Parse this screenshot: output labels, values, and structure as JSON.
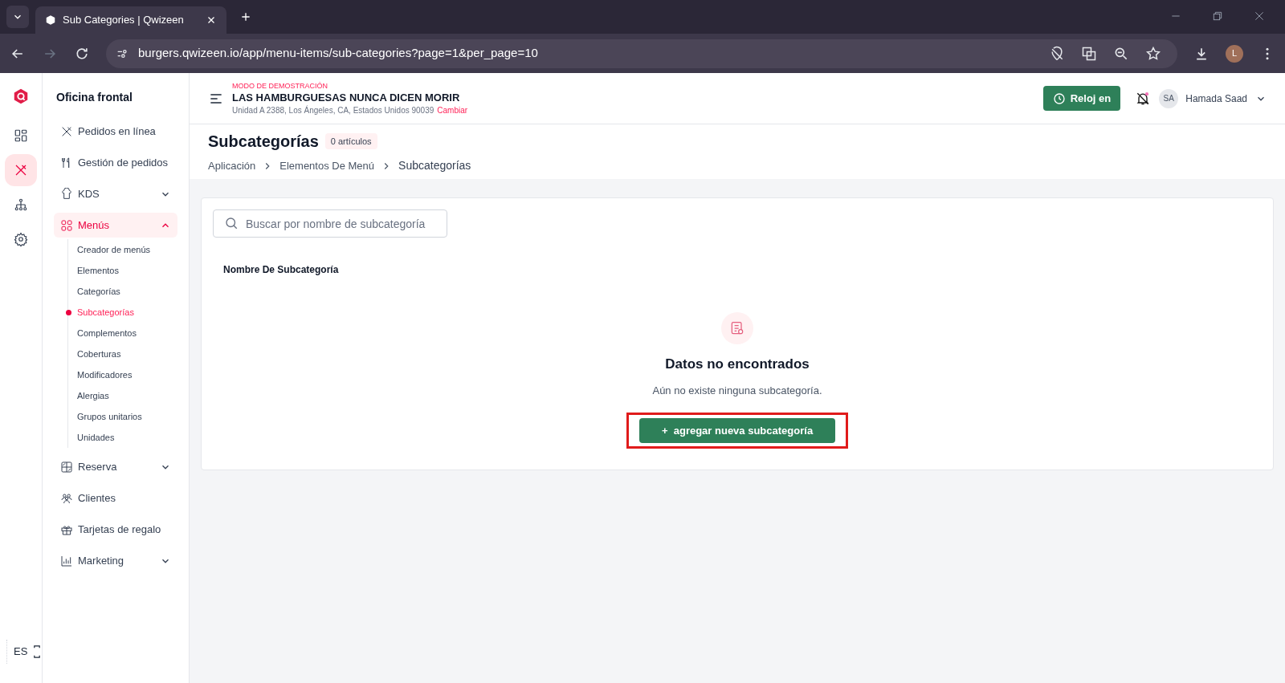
{
  "browser": {
    "tab_title": "Sub Categories | Qwizeen",
    "url": "burgers.qwizeen.io/app/menu-items/sub-categories?page=1&per_page=10",
    "profile_initial": "L"
  },
  "rail": [
    {
      "selected": false
    },
    {
      "selected": true
    },
    {
      "selected": false
    },
    {
      "selected": false
    }
  ],
  "sidebar": {
    "title": "Oficina frontal",
    "items": [
      {
        "kind": "link",
        "label": "Pedidos en línea",
        "selected": false
      },
      {
        "kind": "link",
        "label": "Gestión de pedidos",
        "selected": false
      },
      {
        "kind": "group",
        "label": "KDS",
        "selected": false,
        "expanded": false
      },
      {
        "kind": "group",
        "label": "Menús",
        "selected": true,
        "expanded": true,
        "children": [
          {
            "label": "Creador de menús",
            "selected": false
          },
          {
            "label": "Elementos",
            "selected": false
          },
          {
            "label": "Categorías",
            "selected": false
          },
          {
            "label": "Subcategorías",
            "selected": true
          },
          {
            "label": "Complementos",
            "selected": false
          },
          {
            "label": "Coberturas",
            "selected": false
          },
          {
            "label": "Modificadores",
            "selected": false
          },
          {
            "label": "Alergias",
            "selected": false
          },
          {
            "label": "Grupos unitarios",
            "selected": false
          },
          {
            "label": "Unidades",
            "selected": false
          }
        ]
      },
      {
        "kind": "group",
        "label": "Reserva",
        "selected": false,
        "expanded": false
      },
      {
        "kind": "link",
        "label": "Clientes",
        "selected": false
      },
      {
        "kind": "link",
        "label": "Tarjetas de regalo",
        "selected": false
      },
      {
        "kind": "group",
        "label": "Marketing",
        "selected": false,
        "expanded": false
      }
    ],
    "language": "ES"
  },
  "header": {
    "mode": "MODO DE DEMOSTRACIÓN",
    "restaurant": "LAS HAMBURGUESAS NUNCA DICEN MORIR",
    "address": "Unidad A 2388, Los Ángeles, CA, Estados Unidos 90039",
    "change_link": "Cambiar",
    "clock_button": "Reloj en",
    "user_initials": "SA",
    "user_name": "Hamada Saad"
  },
  "page": {
    "title": "Subcategorías",
    "count_badge": "0 artículos",
    "breadcrumbs": [
      "Aplicación",
      "Elementos De Menú",
      "Subcategorías"
    ]
  },
  "search": {
    "placeholder": "Buscar por nombre de subcategoría"
  },
  "table": {
    "columns": [
      "Nombre De Subcategoría"
    ]
  },
  "empty_state": {
    "title": "Datos no encontrados",
    "message": "Aún no existe ninguna subcategoría.",
    "button": "+  agregar nueva subcategoría",
    "button_highlighted": true
  }
}
